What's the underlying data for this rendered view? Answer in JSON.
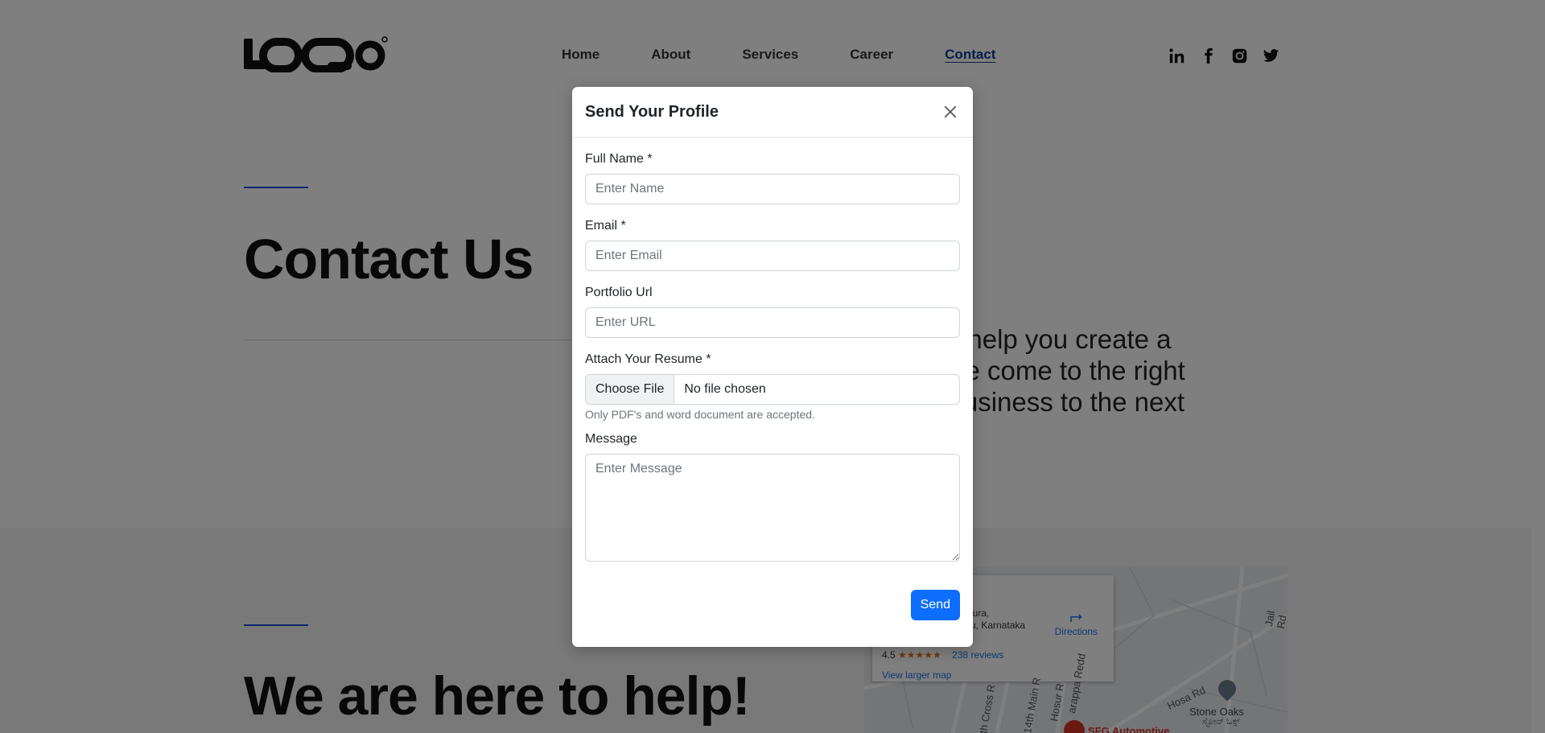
{
  "header": {
    "logo_text": "LOQO",
    "nav": [
      {
        "label": "Home",
        "active": false
      },
      {
        "label": "About",
        "active": false
      },
      {
        "label": "Services",
        "active": false
      },
      {
        "label": "Career",
        "active": false
      },
      {
        "label": "Contact",
        "active": true
      }
    ],
    "social_icons": [
      "linkedin-icon",
      "facebook-icon",
      "instagram-icon",
      "twitter-icon"
    ]
  },
  "hero": {
    "title": "Contact Us",
    "text_line_1": "y to help you create a",
    "text_line_2": "ou've come to the right",
    "text_line_3": "ur business to the next"
  },
  "help_section": {
    "title": "We are here to help!"
  },
  "map": {
    "address_line_1": "pura,",
    "address_line_2": "ru, Karnataka",
    "directions_label": "Directions",
    "rating": "4.5",
    "stars": "★★★★★",
    "reviews": "238 reviews",
    "larger_map": "View larger map",
    "place_name": "SFG Automotive",
    "stone_oaks": "Stone Oaks",
    "stone_oaks_local": "ಸ್ಟೋನ್ ಓಕ್ಸ್",
    "road_jail": "Jail Rd",
    "road_hosa": "Hosa Rd",
    "road_14th": "14th Main R",
    "road_cross": "th Cross R",
    "road_hosur": "Hosur R",
    "road_swarappa": "arappa Redd"
  },
  "modal": {
    "title": "Send Your Profile",
    "fields": {
      "name": {
        "label": "Full Name *",
        "placeholder": "Enter Name"
      },
      "email": {
        "label": "Email *",
        "placeholder": "Enter Email"
      },
      "portfolio": {
        "label": "Portfolio Url",
        "placeholder": "Enter URL"
      },
      "resume": {
        "label": "Attach Your Resume *",
        "button": "Choose File",
        "status": "No file chosen",
        "help": "Only PDF's and word document are accepted."
      },
      "message": {
        "label": "Message",
        "placeholder": "Enter Message"
      }
    },
    "send_label": "Send"
  },
  "colors": {
    "primary_button": "#0d6efd",
    "accent_line": "#1c4fd6",
    "active_nav": "#0d3b8f"
  }
}
